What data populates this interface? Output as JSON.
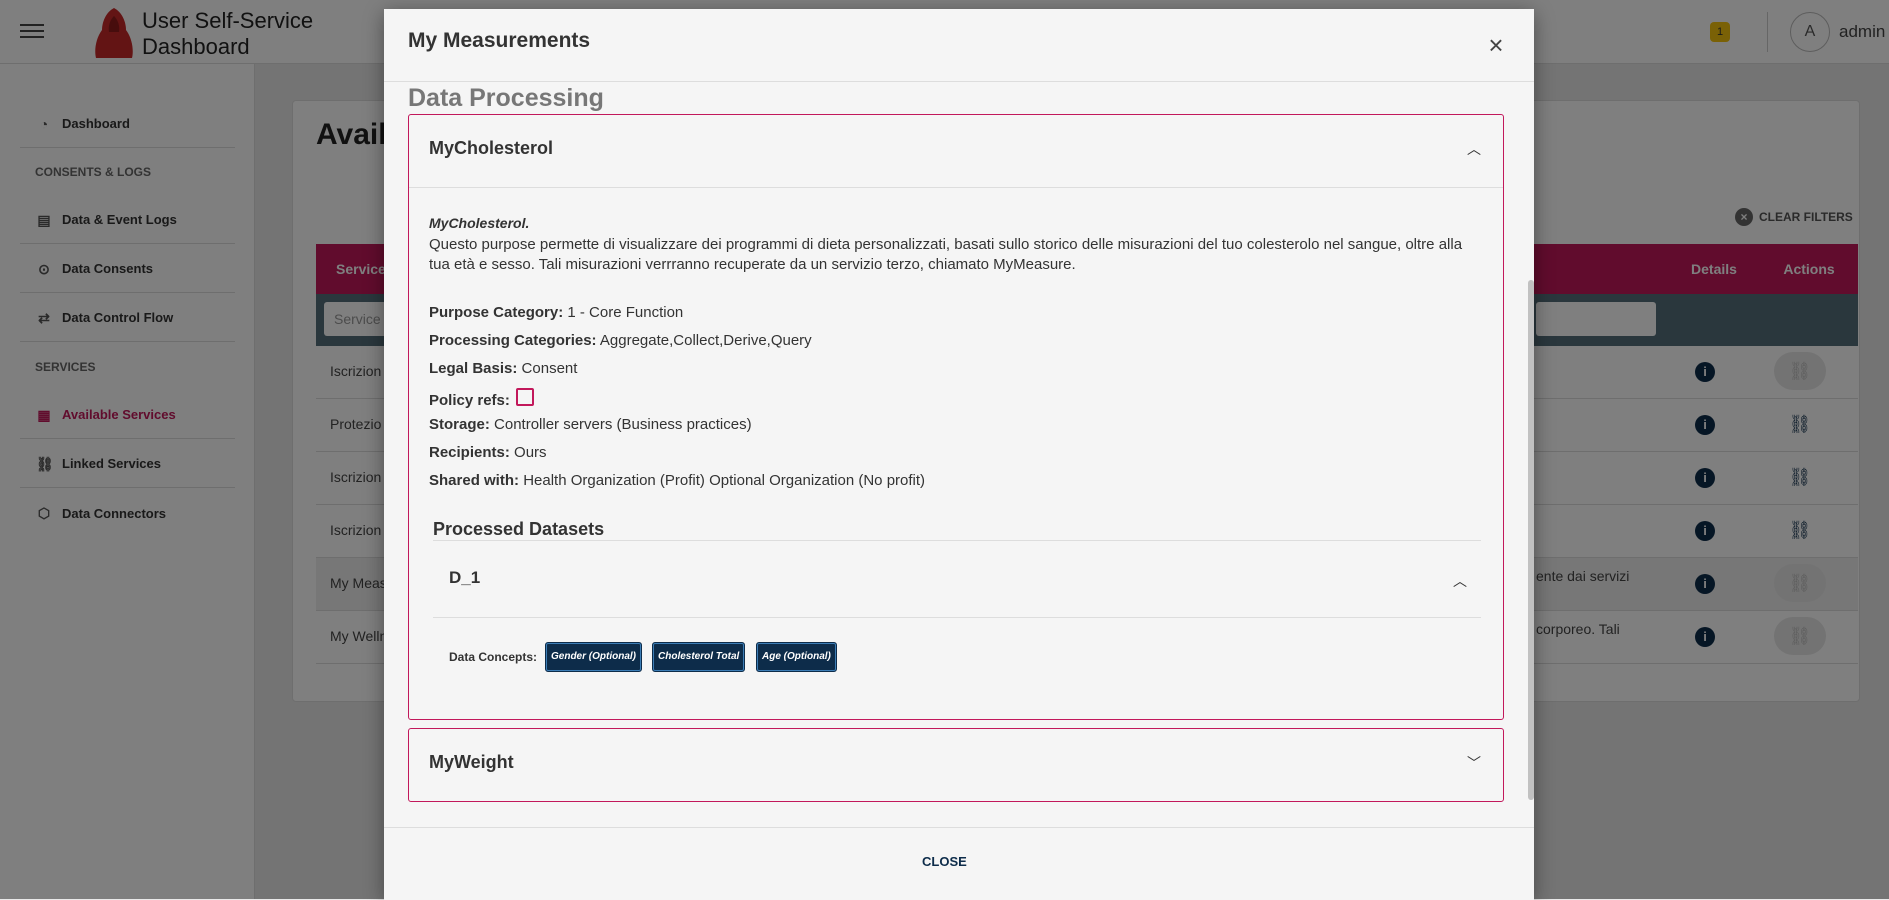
{
  "app": {
    "title_line1": "User Self-Service",
    "title_line2": "Dashboard",
    "notification_count": "1",
    "avatar_letter": "A",
    "user": "admin"
  },
  "sidebar": {
    "dashboard": "Dashboard",
    "consents_header": "CONSENTS & LOGS",
    "event_logs": "Data & Event Logs",
    "data_consents": "Data Consents",
    "data_control_flow": "Data Control Flow",
    "services_header": "SERVICES",
    "available_services": "Available Services",
    "linked_services": "Linked Services",
    "data_connectors": "Data Connectors"
  },
  "main": {
    "title": "Avail",
    "clear_filters": "CLEAR FILTERS",
    "columns": {
      "service": "Service",
      "details": "Details",
      "actions": "Actions"
    },
    "filter_placeholder": "Service",
    "rows": [
      {
        "name": "Iscrizion",
        "desc": ""
      },
      {
        "name": "Protezio",
        "desc": ""
      },
      {
        "name": "Iscrizion",
        "desc": ""
      },
      {
        "name": "Iscrizion",
        "desc": ""
      },
      {
        "name": "My Meas",
        "desc": "ente dai servizi"
      },
      {
        "name": "My Welln",
        "desc": "corporeo. Tali"
      }
    ]
  },
  "modal": {
    "title": "My Measurements",
    "section_title": "Data Processing",
    "purpose1": {
      "title": "MyCholesterol",
      "italic_name": "MyCholesterol.",
      "description": "Questo purpose permette di visualizzare dei programmi di dieta personalizzati, basati sullo storico delle misurazioni del tuo colesterolo nel sangue, oltre alla tua età e sesso. Tali misurazioni verrranno recuperate da un servizio terzo, chiamato MyMeasure.",
      "purpose_category_label": "Purpose Category:",
      "purpose_category": "1 - Core Function",
      "processing_categories_label": "Processing Categories:",
      "processing_categories": "Aggregate,Collect,Derive,Query",
      "legal_basis_label": "Legal Basis:",
      "legal_basis": "Consent",
      "policy_refs_label": "Policy refs:",
      "storage_label": "Storage:",
      "storage": "Controller servers (Business practices)",
      "recipients_label": "Recipients:",
      "recipients": "Ours",
      "shared_with_label": "Shared with:",
      "shared_with": "Health Organization (Profit) Optional Organization (No profit)",
      "processed_datasets_title": "Processed Datasets",
      "dataset_name": "D_1",
      "data_concepts_label": "Data Concepts:",
      "concepts": [
        "Gender (Optional)",
        "Cholesterol Total",
        "Age (Optional)"
      ]
    },
    "purpose2": {
      "title": "MyWeight"
    },
    "close_label": "CLOSE"
  }
}
